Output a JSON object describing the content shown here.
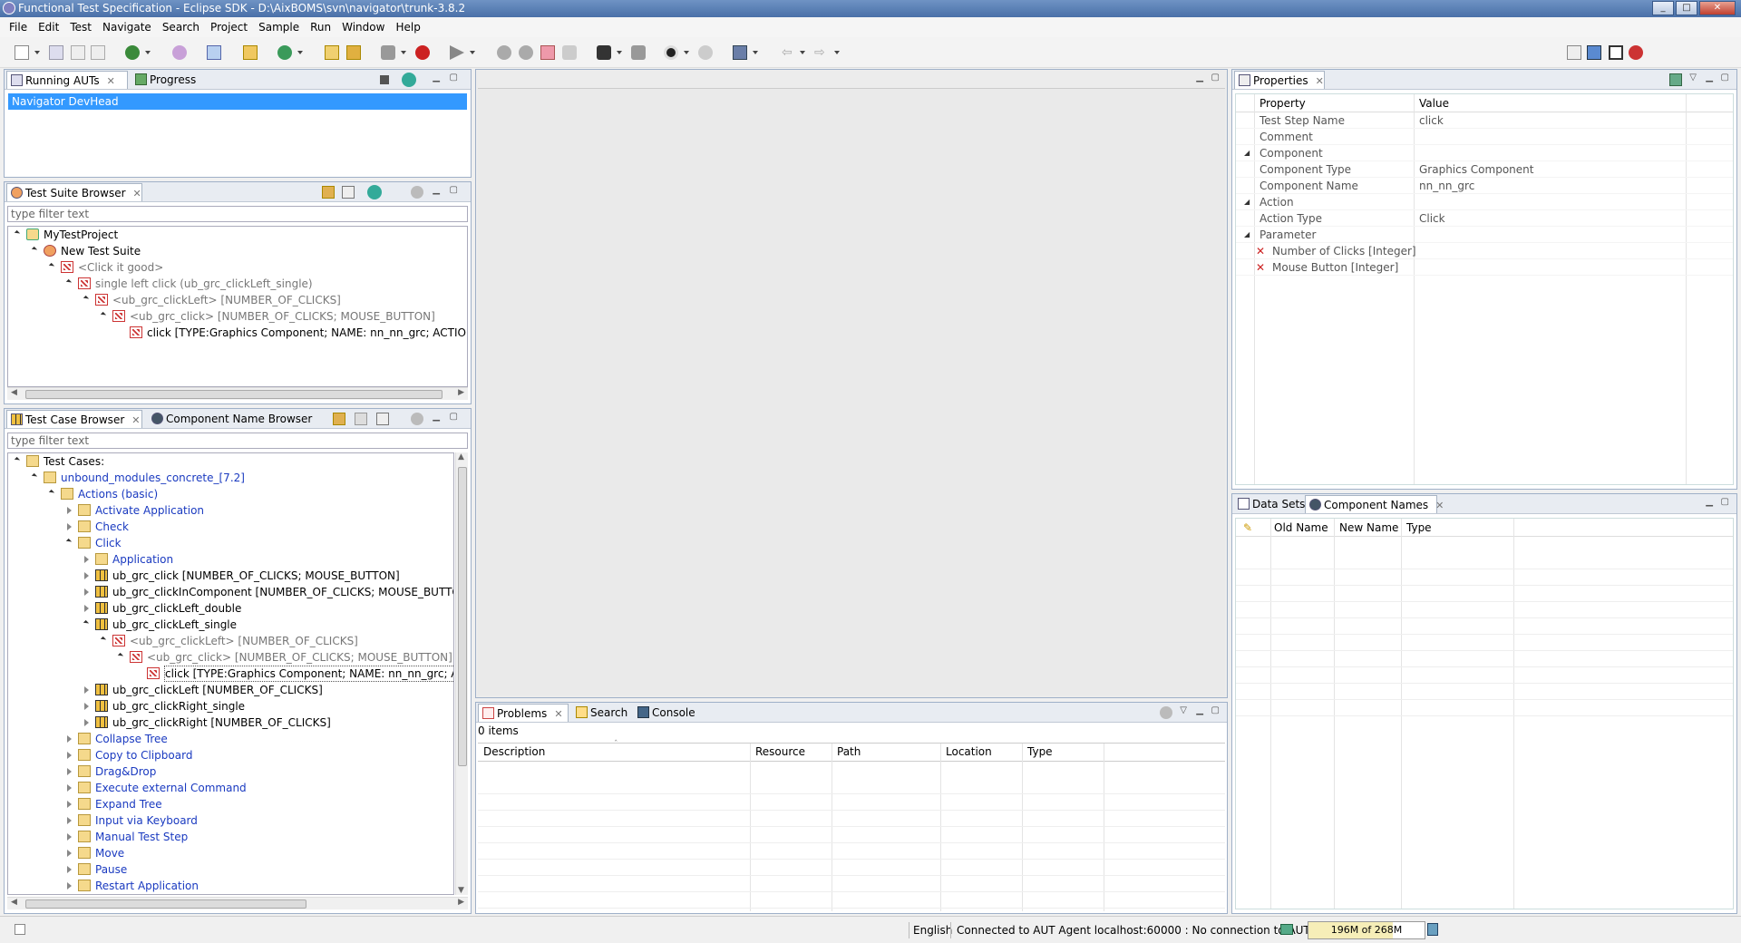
{
  "window": {
    "title": "Functional Test Specification - Eclipse SDK - D:\\AixBOMS\\svn\\navigator\\trunk-3.8.2",
    "controls": [
      "_",
      "□",
      "✕"
    ]
  },
  "menu": [
    "File",
    "Edit",
    "Test",
    "Navigate",
    "Search",
    "Project",
    "Sample",
    "Run",
    "Window",
    "Help"
  ],
  "running_auts": {
    "tabs": [
      "Running AUTs",
      "Progress"
    ],
    "items": [
      "Navigator DevHead"
    ]
  },
  "test_suite_browser": {
    "tab": "Test Suite Browser",
    "filter_placeholder": "type filter text",
    "tree": [
      {
        "label": "MyTestProject",
        "depth": 0,
        "state": "open",
        "icon": "project-icon",
        "style": ""
      },
      {
        "label": "New Test Suite",
        "depth": 1,
        "state": "open",
        "icon": "suite-icon",
        "style": ""
      },
      {
        "label": "<Click it good>",
        "depth": 2,
        "state": "open",
        "icon": "testcase-ref-icon",
        "style": "gray"
      },
      {
        "label": "single left click (ub_grc_clickLeft_single)",
        "depth": 3,
        "state": "open",
        "icon": "testcase-ref-icon",
        "style": "gray"
      },
      {
        "label": "<ub_grc_clickLeft> [NUMBER_OF_CLICKS]",
        "depth": 4,
        "state": "open",
        "icon": "testcase-ref-icon",
        "style": "gray"
      },
      {
        "label": "<ub_grc_click> [NUMBER_OF_CLICKS; MOUSE_BUTTON]",
        "depth": 5,
        "state": "open",
        "icon": "testcase-ref-icon",
        "style": "gray"
      },
      {
        "label": "click [TYPE:Graphics Component; NAME: nn_nn_grc; ACTION: Clic",
        "depth": 6,
        "state": "none",
        "icon": "teststep-icon",
        "style": ""
      }
    ]
  },
  "test_case_browser": {
    "tabs": [
      "Test Case Browser",
      "Component Name Browser"
    ],
    "filter_placeholder": "type filter text",
    "tree": [
      {
        "label": "Test Cases:",
        "depth": 0,
        "state": "open",
        "icon": "folder-icon",
        "style": ""
      },
      {
        "label": "unbound_modules_concrete_[7.2]",
        "depth": 1,
        "state": "open",
        "icon": "folder-icon",
        "style": "blue"
      },
      {
        "label": "Actions (basic)",
        "depth": 2,
        "state": "open",
        "icon": "folder-icon",
        "style": "blue"
      },
      {
        "label": "Activate Application",
        "depth": 3,
        "state": "closed",
        "icon": "folder-icon",
        "style": "blue"
      },
      {
        "label": "Check",
        "depth": 3,
        "state": "closed",
        "icon": "folder-icon",
        "style": "blue"
      },
      {
        "label": "Click",
        "depth": 3,
        "state": "open",
        "icon": "folder-icon",
        "style": "blue"
      },
      {
        "label": "Application",
        "depth": 4,
        "state": "closed",
        "icon": "folder-icon",
        "style": "blue"
      },
      {
        "label": "ub_grc_click [NUMBER_OF_CLICKS; MOUSE_BUTTON]",
        "depth": 4,
        "state": "closed",
        "icon": "testcase-icon",
        "style": ""
      },
      {
        "label": "ub_grc_clickInComponent [NUMBER_OF_CLICKS; MOUSE_BUTTON; X_",
        "depth": 4,
        "state": "closed",
        "icon": "testcase-icon",
        "style": ""
      },
      {
        "label": "ub_grc_clickLeft_double",
        "depth": 4,
        "state": "closed",
        "icon": "testcase-icon",
        "style": ""
      },
      {
        "label": "ub_grc_clickLeft_single",
        "depth": 4,
        "state": "open",
        "icon": "testcase-icon",
        "style": ""
      },
      {
        "label": "<ub_grc_clickLeft> [NUMBER_OF_CLICKS]",
        "depth": 5,
        "state": "open",
        "icon": "testcase-ref-icon",
        "style": "gray"
      },
      {
        "label": "<ub_grc_click> [NUMBER_OF_CLICKS; MOUSE_BUTTON]",
        "depth": 6,
        "state": "open",
        "icon": "testcase-ref-icon",
        "style": "gray"
      },
      {
        "label": "click [TYPE:Graphics Component; NAME: nn_nn_grc; ACTIC",
        "depth": 7,
        "state": "none",
        "icon": "teststep-icon",
        "style": "selected"
      },
      {
        "label": "ub_grc_clickLeft [NUMBER_OF_CLICKS]",
        "depth": 4,
        "state": "closed",
        "icon": "testcase-icon",
        "style": ""
      },
      {
        "label": "ub_grc_clickRight_single",
        "depth": 4,
        "state": "closed",
        "icon": "testcase-icon",
        "style": ""
      },
      {
        "label": "ub_grc_clickRight [NUMBER_OF_CLICKS]",
        "depth": 4,
        "state": "closed",
        "icon": "testcase-icon",
        "style": ""
      },
      {
        "label": "Collapse Tree",
        "depth": 3,
        "state": "closed",
        "icon": "folder-icon",
        "style": "blue"
      },
      {
        "label": "Copy to Clipboard",
        "depth": 3,
        "state": "closed",
        "icon": "folder-icon",
        "style": "blue"
      },
      {
        "label": "Drag&Drop",
        "depth": 3,
        "state": "closed",
        "icon": "folder-icon",
        "style": "blue"
      },
      {
        "label": "Execute external Command",
        "depth": 3,
        "state": "closed",
        "icon": "folder-icon",
        "style": "blue"
      },
      {
        "label": "Expand Tree",
        "depth": 3,
        "state": "closed",
        "icon": "folder-icon",
        "style": "blue"
      },
      {
        "label": "Input via Keyboard",
        "depth": 3,
        "state": "closed",
        "icon": "folder-icon",
        "style": "blue"
      },
      {
        "label": "Manual Test Step",
        "depth": 3,
        "state": "closed",
        "icon": "folder-icon",
        "style": "blue"
      },
      {
        "label": "Move",
        "depth": 3,
        "state": "closed",
        "icon": "folder-icon",
        "style": "blue"
      },
      {
        "label": "Pause",
        "depth": 3,
        "state": "closed",
        "icon": "folder-icon",
        "style": "blue"
      },
      {
        "label": "Restart Application",
        "depth": 3,
        "state": "closed",
        "icon": "folder-icon",
        "style": "blue"
      }
    ]
  },
  "properties": {
    "tab": "Properties",
    "headers": [
      "Property",
      "Value"
    ],
    "rows": [
      {
        "section": false,
        "error": false,
        "name": "Test Step Name",
        "value": "click"
      },
      {
        "section": false,
        "error": false,
        "name": "Comment",
        "value": ""
      },
      {
        "section": true,
        "error": false,
        "name": "Component",
        "value": ""
      },
      {
        "section": false,
        "error": false,
        "name": "Component Type",
        "value": "Graphics Component"
      },
      {
        "section": false,
        "error": false,
        "name": "Component Name",
        "value": "nn_nn_grc"
      },
      {
        "section": true,
        "error": false,
        "name": "Action",
        "value": ""
      },
      {
        "section": false,
        "error": false,
        "name": "Action Type",
        "value": "Click"
      },
      {
        "section": true,
        "error": false,
        "name": "Parameter",
        "value": ""
      },
      {
        "section": false,
        "error": true,
        "name": "Number of Clicks [Integer]",
        "value": ""
      },
      {
        "section": false,
        "error": true,
        "name": "Mouse Button [Integer]",
        "value": ""
      }
    ]
  },
  "data_sets": {
    "tabs": [
      "Data Sets",
      "Component Names"
    ],
    "headers": [
      "Old Name",
      "New Name",
      "Type"
    ]
  },
  "problems": {
    "tabs": [
      "Problems",
      "Search",
      "Console"
    ],
    "count": "0 items",
    "headers": [
      "Description",
      "Resource",
      "Path",
      "Location",
      "Type"
    ]
  },
  "status": {
    "language": "English",
    "connection": "Connected to AUT Agent localhost:60000 : No connection to AUT",
    "memory": "196M of 268M",
    "memory_fraction": 0.73
  },
  "colors": {
    "selection": "#3399ff",
    "link_blue": "#1a3ac0",
    "error_red": "#cc2222"
  }
}
